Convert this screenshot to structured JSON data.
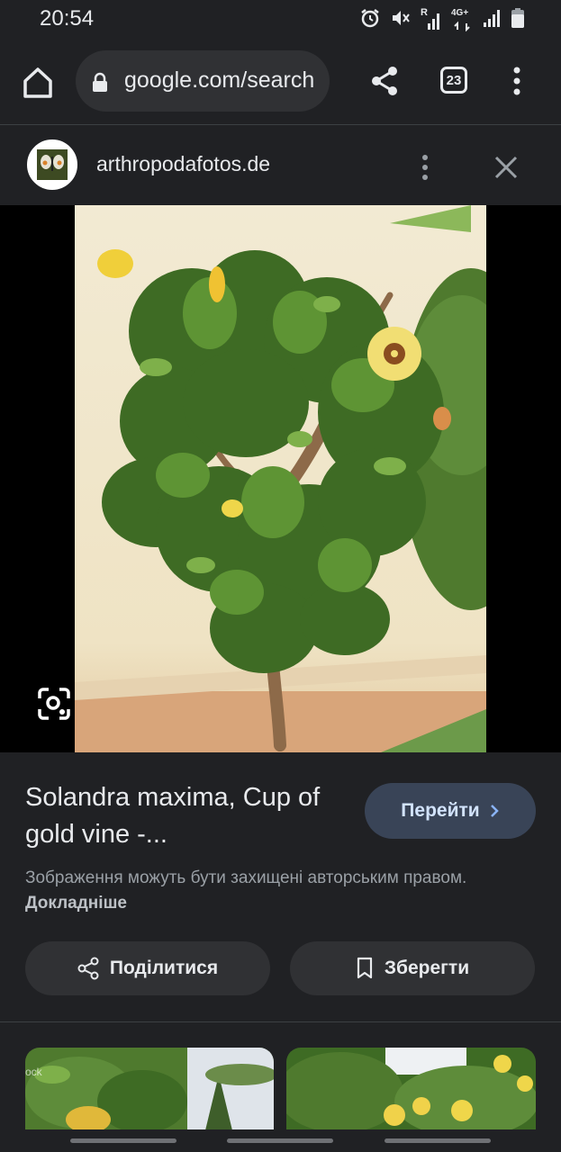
{
  "status_bar": {
    "time": "20:54",
    "icons": [
      "alarm-icon",
      "mute-icon",
      "signal-r-icon",
      "4g-icon",
      "signal-icon",
      "battery-icon"
    ],
    "network_label": "4G+",
    "roaming_label": "R"
  },
  "toolbar": {
    "url": "google.com/search",
    "tab_count": "23"
  },
  "site": {
    "name": "arthropodafotos.de"
  },
  "result": {
    "title": "Solandra maxima, Cup of gold vine -...",
    "visit_label": "Перейти",
    "copyright_text": "Зображення можуть бути захищені авторським правом.",
    "learn_more": "Докладніше",
    "share_label": "Поділитися",
    "save_label": "Зберегти"
  },
  "related": {
    "thumb1_watermark": "ock"
  },
  "colors": {
    "background": "#202124",
    "surface": "#303134",
    "accent_button": "#394457",
    "accent_text": "#d2e3fc",
    "text_primary": "#e8eaed",
    "text_secondary": "#9aa0a6"
  }
}
